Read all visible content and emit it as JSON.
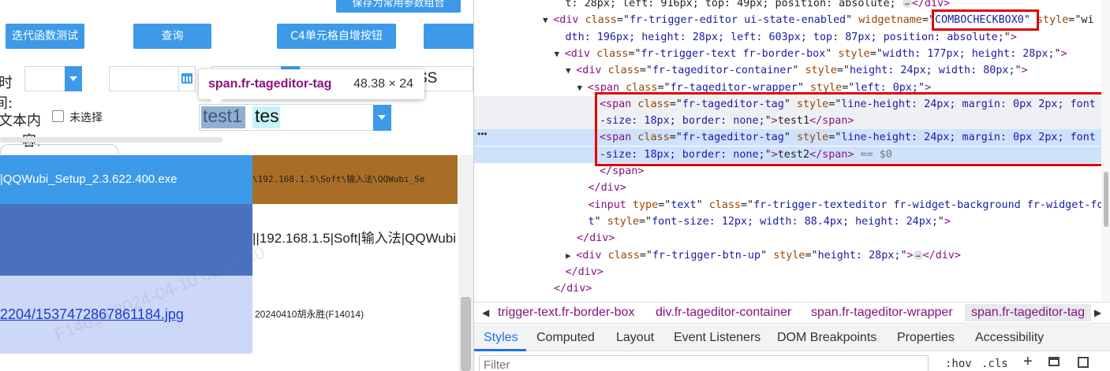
{
  "app": {
    "save_params_button": "保存为常用参数组合",
    "buttons": [
      "迭代函数测试",
      "查询",
      "C4单元格自增按钮"
    ],
    "label_1": "时间:",
    "label_2": "文本内容:",
    "checkbox_label": "未选择",
    "tag_1": "test1",
    "tag_input_value": "tes",
    "partial_value": "SS",
    "tooltip": {
      "selector": "span.fr-tageditor-tag",
      "size": "48.38 × 24"
    },
    "rows": [
      {
        "c1": "|QQWubi_Setup_2.3.622.400.exe",
        "c2": "\\192.168.1.5\\Soft\\输入法\\QQWubi_Se"
      },
      {
        "c1": "",
        "c2": "||192.168.1.5|Soft|输入法|QQWubi"
      },
      {
        "c1": "2204/1537472867861184.jpg",
        "c2": "20240410胡永胜(F14014)"
      }
    ],
    "watermark": "F14014 2024-04-10 09:23:40"
  },
  "devtools": {
    "html_lines": [
      {
        "indent": 7,
        "parts": [
          [
            "txt",
            "t: 28px; left: 916px; top: 49px; position: absolute; "
          ],
          [
            "ell",
            "…"
          ],
          [
            "tag",
            "</div>"
          ]
        ]
      },
      {
        "indent": 6,
        "tri": "▼",
        "parts": [
          [
            "tag",
            "<div "
          ],
          [
            "attr",
            "class"
          ],
          [
            "txt",
            "=\""
          ],
          [
            "val",
            "fr-trigger-editor ui-state-enabled"
          ],
          [
            "txt",
            "\" "
          ],
          [
            "attr",
            "widgetname"
          ],
          [
            "txt",
            "=\""
          ],
          [
            "val",
            "COMBOCHECKBOX0"
          ],
          [
            "txt",
            "\" "
          ],
          [
            "attr",
            "style"
          ],
          [
            "txt",
            "=\"wi"
          ]
        ]
      },
      {
        "indent": 7,
        "parts": [
          [
            "val",
            "dth: 196px; height: 28px; left: 603px; top: 87px; position: absolute;"
          ],
          [
            "txt",
            "\""
          ],
          [
            "tag",
            ">"
          ]
        ]
      },
      {
        "indent": 7,
        "tri": "▼",
        "parts": [
          [
            "tag",
            "<div "
          ],
          [
            "attr",
            "class"
          ],
          [
            "txt",
            "=\""
          ],
          [
            "val",
            "fr-trigger-text fr-border-box"
          ],
          [
            "txt",
            "\" "
          ],
          [
            "attr",
            "style"
          ],
          [
            "txt",
            "=\""
          ],
          [
            "val",
            "width: 177px; height: 28px;"
          ],
          [
            "txt",
            "\""
          ],
          [
            "tag",
            ">"
          ]
        ]
      },
      {
        "indent": 8,
        "tri": "▼",
        "parts": [
          [
            "tag",
            "<div "
          ],
          [
            "attr",
            "class"
          ],
          [
            "txt",
            "=\""
          ],
          [
            "val",
            "fr-tageditor-container"
          ],
          [
            "txt",
            "\" "
          ],
          [
            "attr",
            "style"
          ],
          [
            "txt",
            "=\""
          ],
          [
            "val",
            "height: 24px; width: 80px;"
          ],
          [
            "txt",
            "\""
          ],
          [
            "tag",
            ">"
          ]
        ]
      },
      {
        "indent": 9,
        "tri": "▼",
        "parts": [
          [
            "tag",
            "<span "
          ],
          [
            "attr",
            "class"
          ],
          [
            "txt",
            "=\""
          ],
          [
            "val",
            "fr-tageditor-wrapper"
          ],
          [
            "txt",
            "\" "
          ],
          [
            "attr",
            "style"
          ],
          [
            "txt",
            "=\""
          ],
          [
            "val",
            "left: 0px;"
          ],
          [
            "txt",
            "\""
          ],
          [
            "tag",
            ">"
          ]
        ]
      },
      {
        "indent": 10,
        "parts": [
          [
            "tag",
            "<span "
          ],
          [
            "attr",
            "class"
          ],
          [
            "txt",
            "=\""
          ],
          [
            "val",
            "fr-tageditor-tag"
          ],
          [
            "txt",
            "\" "
          ],
          [
            "attr",
            "style"
          ],
          [
            "txt",
            "=\""
          ],
          [
            "val",
            "line-height: 24px; margin: 0px 2px; font"
          ]
        ]
      },
      {
        "indent": 10,
        "parts": [
          [
            "val",
            "-size: 18px; border: none;"
          ],
          [
            "txt",
            "\""
          ],
          [
            "tag",
            ">"
          ],
          [
            "txt",
            "test1"
          ],
          [
            "tag",
            "</span>"
          ]
        ]
      },
      {
        "indent": 10,
        "parts": [
          [
            "tag",
            "<span "
          ],
          [
            "attr",
            "class"
          ],
          [
            "txt",
            "=\""
          ],
          [
            "val",
            "fr-tageditor-tag"
          ],
          [
            "txt",
            "\" "
          ],
          [
            "attr",
            "style"
          ],
          [
            "txt",
            "=\""
          ],
          [
            "val",
            "line-height: 24px; margin: 0px 2px; font"
          ]
        ]
      },
      {
        "indent": 10,
        "parts": [
          [
            "val",
            "-size: 18px; border: none;"
          ],
          [
            "txt",
            "\""
          ],
          [
            "tag",
            ">"
          ],
          [
            "txt",
            "test2"
          ],
          [
            "tag",
            "</span>"
          ],
          [
            "txt",
            " == $0"
          ]
        ]
      },
      {
        "indent": 10,
        "parts": [
          [
            "tag",
            "</span>"
          ]
        ]
      },
      {
        "indent": 9,
        "parts": [
          [
            "tag",
            "</div>"
          ]
        ]
      },
      {
        "indent": 9,
        "parts": [
          [
            "tag",
            "<input "
          ],
          [
            "attr",
            "type"
          ],
          [
            "txt",
            "=\""
          ],
          [
            "val",
            "text"
          ],
          [
            "txt",
            "\" "
          ],
          [
            "attr",
            "class"
          ],
          [
            "txt",
            "=\""
          ],
          [
            "val",
            "fr-trigger-texteditor fr-widget-background fr-widget-fon"
          ]
        ]
      },
      {
        "indent": 9,
        "parts": [
          [
            "val",
            "t"
          ],
          [
            "txt",
            "\" "
          ],
          [
            "attr",
            "style"
          ],
          [
            "txt",
            "=\""
          ],
          [
            "val",
            "font-size: 12px; width: 88.4px; height: 24px;"
          ],
          [
            "txt",
            "\""
          ],
          [
            "tag",
            ">"
          ]
        ]
      },
      {
        "indent": 8,
        "parts": [
          [
            "tag",
            "</div>"
          ]
        ]
      },
      {
        "indent": 8,
        "tri": "▶",
        "parts": [
          [
            "tag",
            "<div "
          ],
          [
            "attr",
            "class"
          ],
          [
            "txt",
            "=\""
          ],
          [
            "val",
            "fr-trigger-btn-up"
          ],
          [
            "txt",
            "\" "
          ],
          [
            "attr",
            "style"
          ],
          [
            "txt",
            "=\""
          ],
          [
            "val",
            "height: 28px;"
          ],
          [
            "txt",
            "\""
          ],
          [
            "tag",
            ">"
          ],
          [
            "ell",
            "…"
          ],
          [
            "tag",
            "</div>"
          ]
        ]
      },
      {
        "indent": 7,
        "parts": [
          [
            "tag",
            "</div>"
          ]
        ]
      },
      {
        "indent": 6,
        "parts": [
          [
            "tag",
            "</div>"
          ]
        ]
      }
    ],
    "breadcrumbs": [
      "trigger-text.fr-border-box",
      "div.fr-tageditor-container",
      "span.fr-tageditor-wrapper",
      "span.fr-tageditor-tag"
    ],
    "tabs": [
      "Styles",
      "Computed",
      "Layout",
      "Event Listeners",
      "DOM Breakpoints",
      "Properties",
      "Accessibility"
    ],
    "filter_placeholder": "Filter",
    "filter_tools": [
      ":hov",
      ".cls",
      "+"
    ],
    "colors": {
      "highlight_red": "#e00000",
      "selected_row": "#cfe2fc",
      "tab_active": "#1a73e8"
    }
  }
}
